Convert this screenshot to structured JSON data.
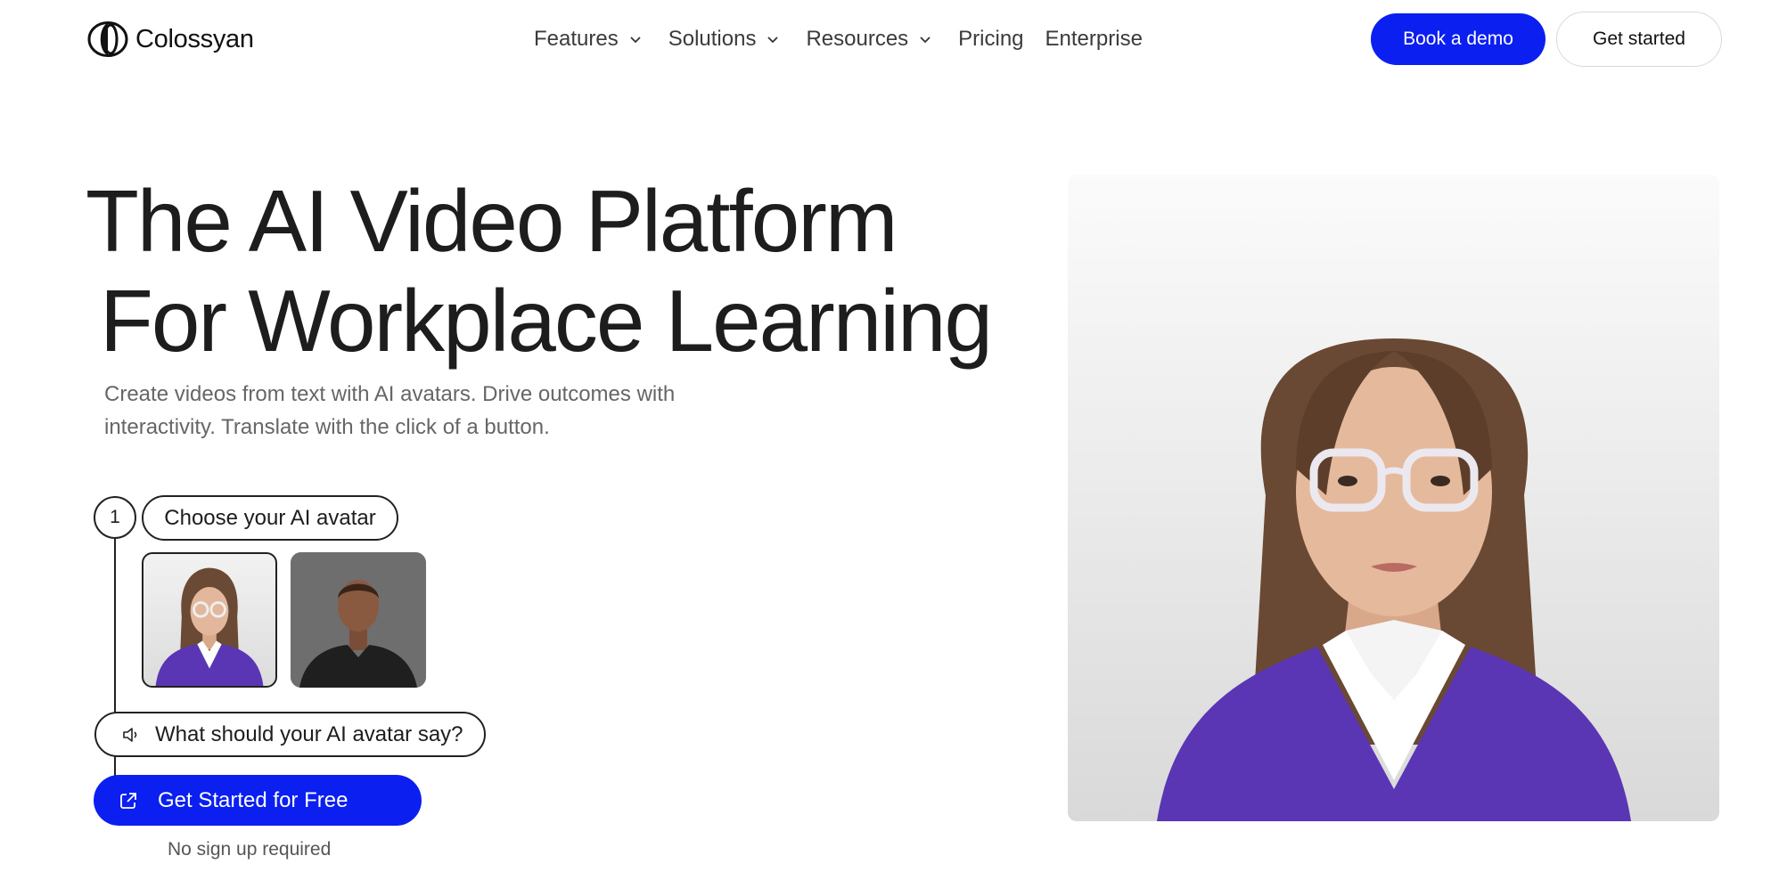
{
  "nav": {
    "logo_text": "Colossyan",
    "menu": [
      {
        "label": "Features",
        "has_dropdown": true
      },
      {
        "label": "Solutions",
        "has_dropdown": true
      },
      {
        "label": "Resources",
        "has_dropdown": true
      },
      {
        "label": "Pricing",
        "has_dropdown": false
      },
      {
        "label": "Enterprise",
        "has_dropdown": false
      }
    ],
    "book_demo_label": "Book a demo",
    "get_started_label": "Get started"
  },
  "hero": {
    "title_line1": "The AI Video Platform",
    "title_line2": "For Workplace Learning",
    "subtitle": "Create videos from text with AI avatars. Drive outcomes with interactivity. Translate with the click of a button."
  },
  "steps": {
    "step_number": "1",
    "choose_label": "Choose your AI avatar",
    "say_label": "What should your AI avatar say?",
    "cta_label": "Get Started for Free",
    "cta_note": "No sign up required",
    "avatars": [
      {
        "name": "avatar-woman-glasses",
        "selected": true
      },
      {
        "name": "avatar-man",
        "selected": false
      }
    ]
  },
  "colors": {
    "accent": "#0a1ff0",
    "text": "#1d1d1d",
    "muted": "#666666",
    "sweater": "#5a36b4"
  },
  "icons": [
    "logo-mark-icon",
    "chevron-down-icon",
    "speaker-icon",
    "external-link-icon"
  ]
}
